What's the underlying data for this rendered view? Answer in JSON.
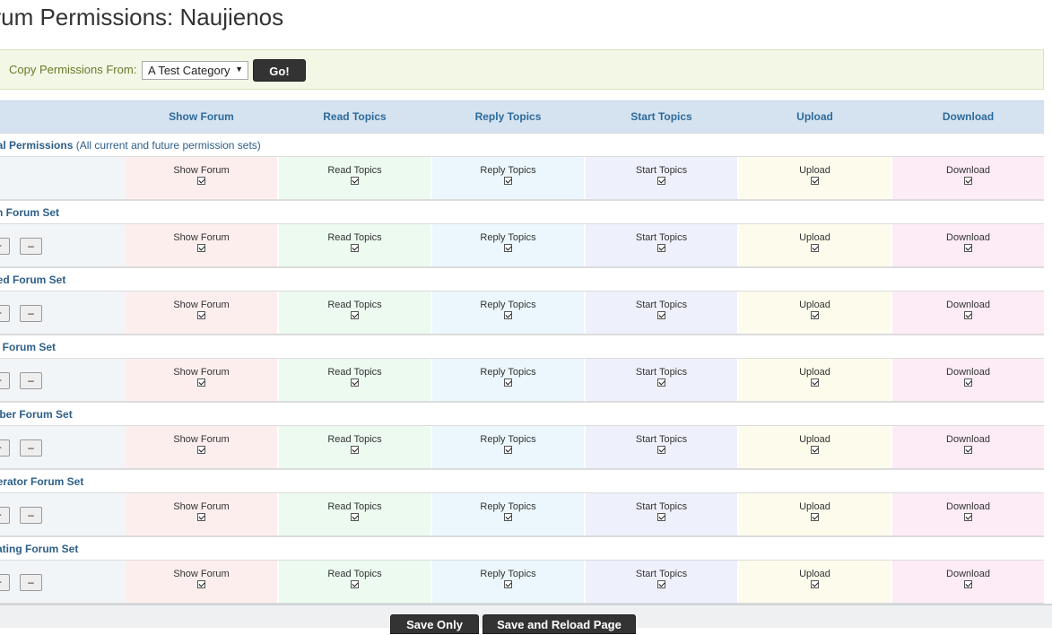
{
  "page_title": "orum Permissions: Naujienos",
  "copy": {
    "label": "Copy Permissions From:",
    "selected": "A Test Category",
    "go_label": "Go!"
  },
  "columns": [
    "Show Forum",
    "Read Topics",
    "Reply Topics",
    "Start Topics",
    "Upload",
    "Download"
  ],
  "global": {
    "name": "obal Permissions",
    "desc": "(All current and future permission sets)"
  },
  "sets": [
    {
      "name": "min Forum Set"
    },
    {
      "name": "nned Forum Set"
    },
    {
      "name": "est Forum Set"
    },
    {
      "name": "ember Forum Set"
    },
    {
      "name": "oderator Forum Set"
    },
    {
      "name": "lidating Forum Set"
    }
  ],
  "add_label": "+",
  "remove_label": "–",
  "footer": {
    "save_only": "Save Only",
    "save_reload": "Save and Reload Page"
  }
}
